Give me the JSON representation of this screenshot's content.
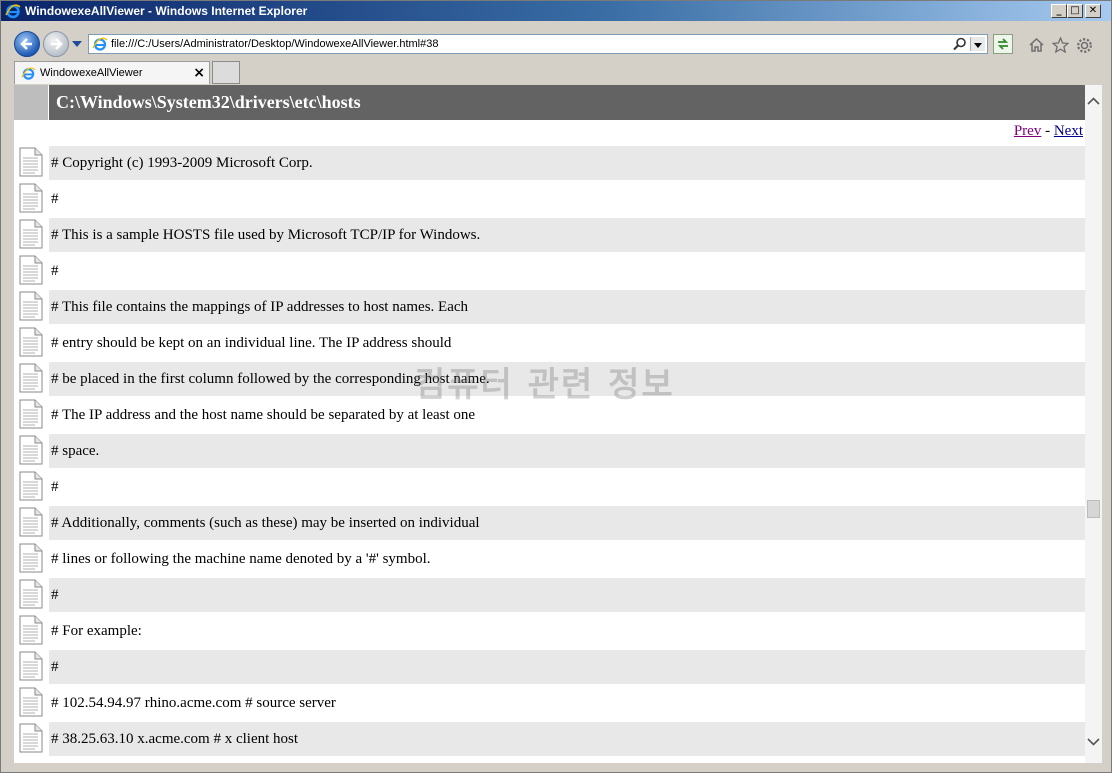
{
  "window": {
    "title": "WindowexeAllViewer - Windows Internet Explorer",
    "controls": {
      "minimize": "_",
      "maximize": "□",
      "close": "✕"
    }
  },
  "navbar": {
    "url": "file:///C:/Users/Administrator/Desktop/WindowexeAllViewer.html#38",
    "icons": [
      "back-icon",
      "forward-icon",
      "history-dropdown-icon",
      "search-icon",
      "compatibility-refresh-icon",
      "home-icon",
      "favorites-star-icon",
      "tools-gear-icon"
    ]
  },
  "tabs": [
    {
      "label": "WindowexeAllViewer",
      "close": "×"
    }
  ],
  "page": {
    "header_title": "C:\\Windows\\System32\\drivers\\etc\\hosts",
    "pager": {
      "prev": "Prev",
      "separator": "-",
      "next": "Next"
    },
    "watermark": "컴퓨터 관련 정보",
    "lines": [
      "# Copyright (c) 1993-2009 Microsoft Corp.",
      "#",
      "# This is a sample HOSTS file used by Microsoft TCP/IP for Windows.",
      "#",
      "# This file contains the mappings of IP addresses to host names. Each",
      "# entry should be kept on an individual line. The IP address should",
      "# be placed in the first column followed by the corresponding host name.",
      "# The IP address and the host name should be separated by at least one",
      "# space.",
      "#",
      "# Additionally, comments (such as these) may be inserted on individual",
      "# lines or following the machine name denoted by a '#' symbol.",
      "#",
      "# For example:",
      "#",
      "# 102.54.94.97 rhino.acme.com # source server",
      "# 38.25.63.10 x.acme.com # x client host"
    ]
  },
  "colors": {
    "header_bg": "#636363",
    "row_shade": "#e8e8e8",
    "prev_link": "#800080",
    "next_link": "#00008b"
  }
}
